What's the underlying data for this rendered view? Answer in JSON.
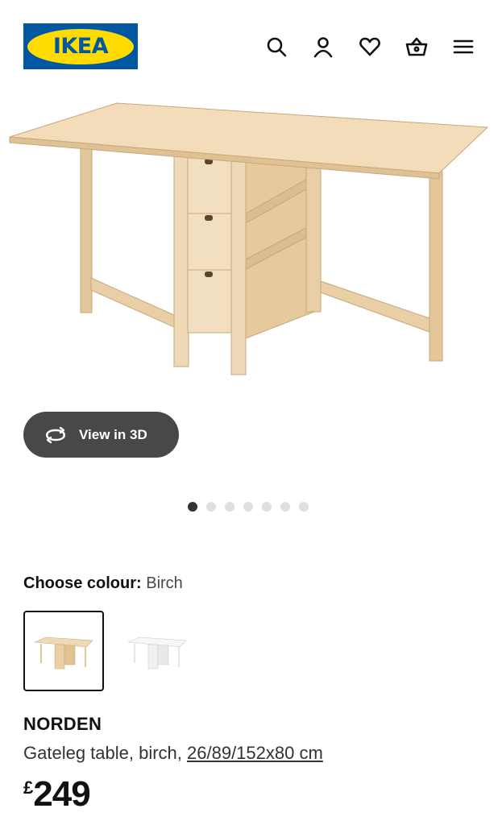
{
  "header": {
    "logo_text": "IKEA",
    "icons": [
      "search-icon",
      "account-icon",
      "heart-icon",
      "basket-icon",
      "menu-icon"
    ]
  },
  "gallery": {
    "view3d_label": "View in 3D",
    "slide_count": 7,
    "active_slide": 1
  },
  "colour": {
    "label": "Choose colour:",
    "value": "Birch",
    "options": [
      "birch",
      "white"
    ],
    "selected": "birch"
  },
  "product": {
    "name": "NORDEN",
    "description": "Gateleg table, birch, ",
    "dimensions": "26/89/152x80 cm",
    "currency": "£",
    "price": "249"
  },
  "colors": {
    "brand_blue": "#0058a3",
    "brand_yellow": "#ffdb00",
    "button_dark": "#484848",
    "birch": "#efd9b6"
  }
}
